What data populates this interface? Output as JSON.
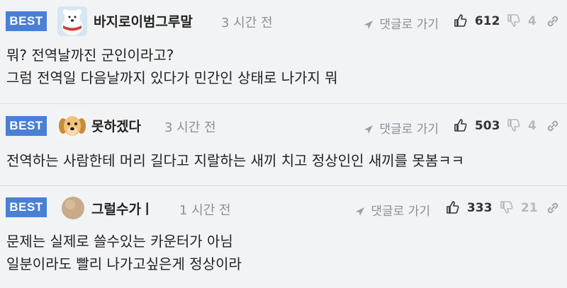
{
  "comments": [
    {
      "badge": "BEST",
      "avatar": "polar-bear-avatar",
      "nickname": "바지로이범그루말",
      "time": "3 시간 전",
      "reply_label": "댓글로 가기",
      "upvotes": "612",
      "downvotes": "4",
      "lines": [
        "뭐? 전역날까진 군인이라고?",
        "그럼 전역일 다음날까지 있다가 민간인 상태로 나가지 뭐"
      ]
    },
    {
      "badge": "BEST",
      "avatar": "puppy-avatar",
      "nickname": "못하겠다",
      "time": "3 시간 전",
      "reply_label": "댓글로 가기",
      "upvotes": "503",
      "downvotes": "4",
      "lines": [
        "전역하는 사람한테 머리 길다고 지랄하는 새끼 치고 정상인인 새끼를 못봄ㅋㅋ"
      ]
    },
    {
      "badge": "BEST",
      "avatar": "default-circle-avatar",
      "nickname": "그럴수가ㅣ",
      "time": "1 시간 전",
      "reply_label": "댓글로 가기",
      "upvotes": "333",
      "downvotes": "21",
      "lines": [
        "문제는 실제로 쓸수있는 카운터가 아님",
        "일분이라도 빨리 나가고싶은게 정상이라"
      ]
    }
  ],
  "colors": {
    "best": "#4a7fd6",
    "meta": "#8a8f96",
    "background": "#f2f3f5"
  }
}
